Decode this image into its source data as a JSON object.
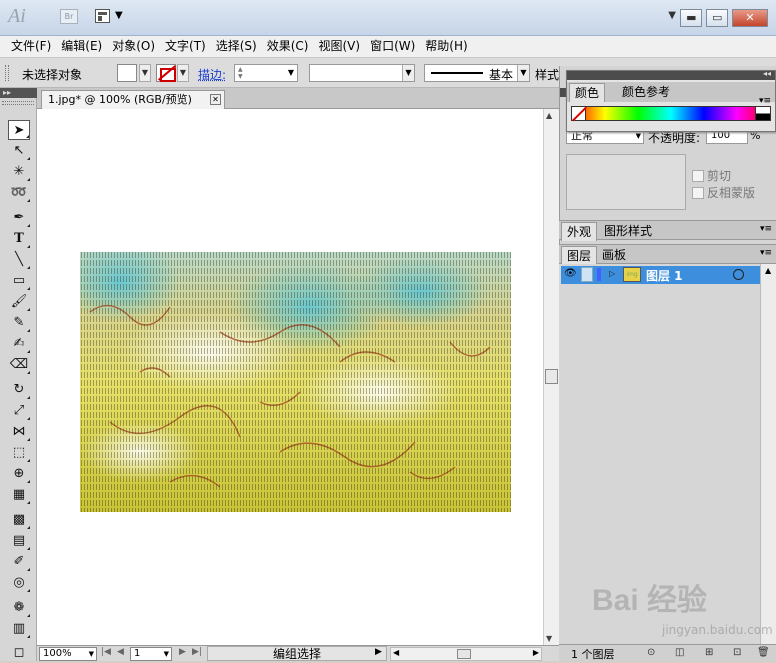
{
  "titlebar": {
    "app_logo": "Ai",
    "bridge_label": "Br",
    "workspace_arrow": "▼",
    "title_dropdown": "▼",
    "minimize": "▬",
    "restore": "▭",
    "close": "✕"
  },
  "menubar": {
    "items": [
      "文件(F)",
      "编辑(E)",
      "对象(O)",
      "文字(T)",
      "选择(S)",
      "效果(C)",
      "视图(V)",
      "窗口(W)",
      "帮助(H)"
    ]
  },
  "controlbar": {
    "no_selection": "未选择对象",
    "stroke_label": "描边:",
    "stroke_weight": "",
    "brush_label": "基本",
    "style_label": "样式:"
  },
  "document": {
    "tab_title": "1.jpg* @ 100% (RGB/预览)",
    "tab_close": "✕"
  },
  "statusbar": {
    "zoom": "100%",
    "page": "1",
    "status_text": "编组选择",
    "status_arrow": "▶"
  },
  "color_panel": {
    "tabs": [
      "颜色",
      "颜色参考"
    ],
    "menu_icon": "▾≡"
  },
  "transparency": {
    "blend_mode": "正常",
    "opacity_label": "不透明度:",
    "opacity_value": "100",
    "opacity_unit": "%",
    "clip_label": "剪切",
    "invert_mask_label": "反相蒙版"
  },
  "appearance_panel": {
    "tabs": [
      "外观",
      "图形样式"
    ]
  },
  "layers_panel": {
    "tabs": [
      "图层",
      "画板"
    ],
    "layers": [
      {
        "name": "图层 1"
      }
    ],
    "layer_count": "1 个图层"
  },
  "watermark": {
    "logo_text": "Bai 经验",
    "sub_text": "jingyan.baidu.com"
  },
  "icons": {
    "tools": [
      "selection-tool",
      "direct-selection-tool",
      "magic-wand-tool",
      "lasso-tool",
      "pen-tool",
      "type-tool",
      "line-tool",
      "rectangle-tool",
      "paintbrush-tool",
      "pencil-tool",
      "blob-brush-tool",
      "eraser-tool",
      "rotate-tool",
      "scale-tool",
      "width-tool",
      "free-transform-tool",
      "shape-builder-tool",
      "perspective-grid-tool",
      "mesh-tool",
      "gradient-tool",
      "eyedropper-tool",
      "blend-tool",
      "symbol-sprayer-tool",
      "column-graph-tool",
      "artboard-tool"
    ]
  },
  "colors": {
    "layer_highlight": "#3d8edc",
    "layer_color_bar": "#4060ff",
    "stroke_none_red": "#cc0000"
  }
}
